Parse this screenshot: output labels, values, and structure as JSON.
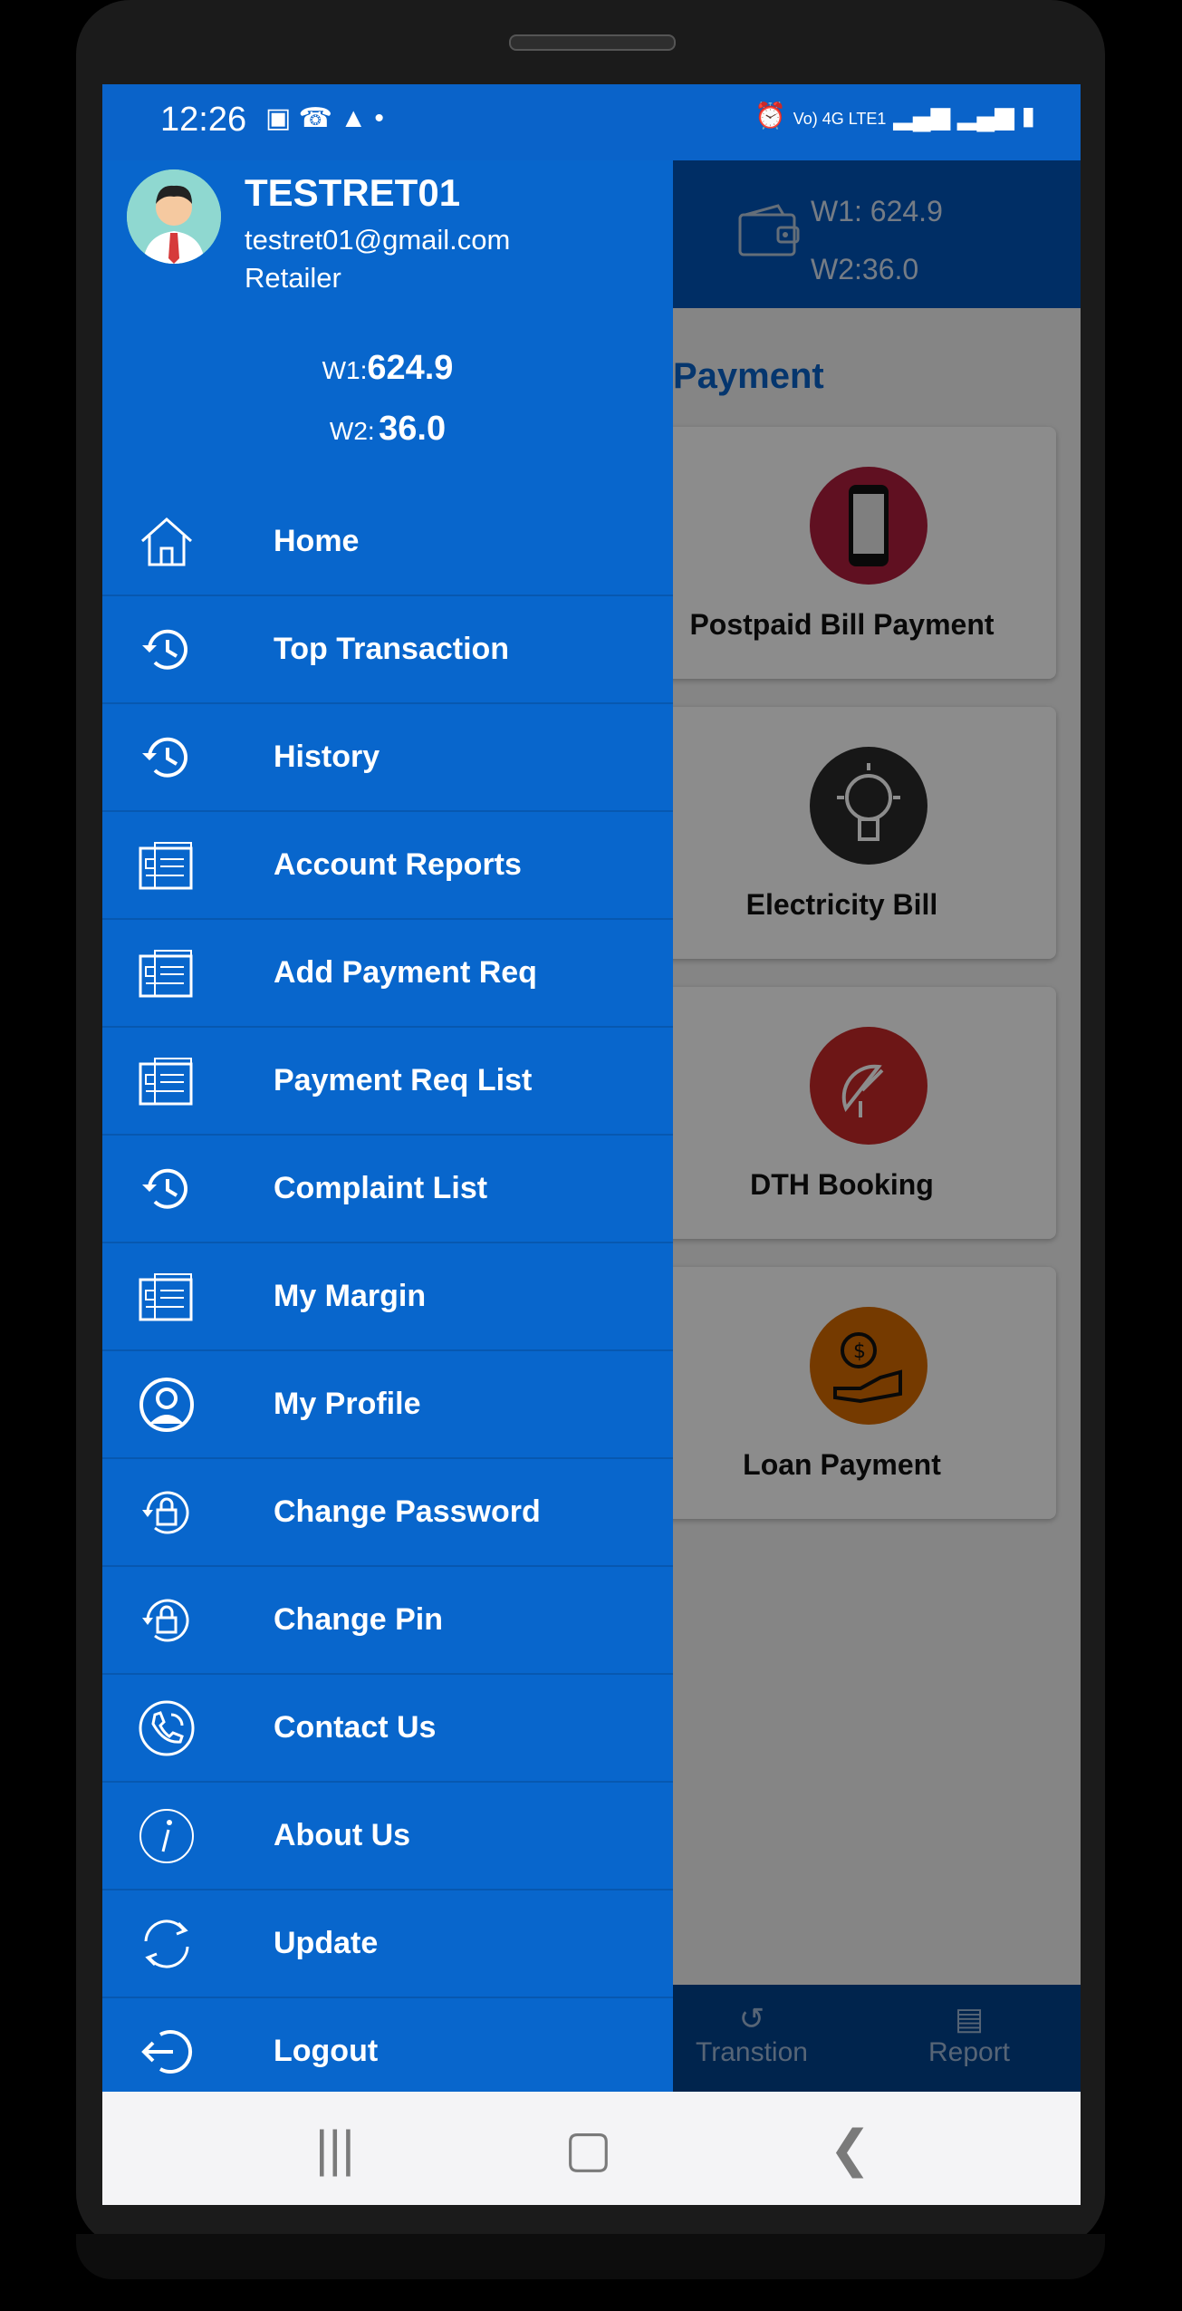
{
  "status_bar": {
    "time": "12:26",
    "network": "Vo) 4G LTE1"
  },
  "app": {
    "wallet": {
      "w1_key": "W1:",
      "w1_value": "624.9",
      "w2_key": "W2:",
      "w2_value": "36.0"
    },
    "section_title": "Payment",
    "cards": [
      {
        "label": "Postpaid Bill Payment",
        "icon": "mobile-phone-icon",
        "color": "#b01e3c"
      },
      {
        "label": "Electricity Bill",
        "icon": "light-bulb-icon",
        "color": "#2a2a2a"
      },
      {
        "label": "DTH Booking",
        "icon": "satellite-dish-icon",
        "color": "#c62828"
      },
      {
        "label": "Loan Payment",
        "icon": "hand-coin-icon",
        "color": "#d66a00"
      }
    ],
    "bottom_nav": {
      "transaction": "Transtion",
      "report": "Report"
    }
  },
  "drawer": {
    "user": {
      "name": "TESTRET01",
      "email": "testret01@gmail.com",
      "role": "Retailer"
    },
    "wallet": {
      "w1_key": "W1:",
      "w1_value": "624.9",
      "w2_key": "W2:",
      "w2_value": "36.0"
    },
    "menu": [
      {
        "label": "Home",
        "icon": "home-icon"
      },
      {
        "label": "Top Transaction",
        "icon": "history-icon"
      },
      {
        "label": "History",
        "icon": "history-icon"
      },
      {
        "label": "Account Reports",
        "icon": "report-icon"
      },
      {
        "label": "Add Payment Req",
        "icon": "report-icon"
      },
      {
        "label": "Payment Req List",
        "icon": "report-icon"
      },
      {
        "label": "Complaint List",
        "icon": "history-icon"
      },
      {
        "label": "My Margin",
        "icon": "report-icon"
      },
      {
        "label": "My Profile",
        "icon": "profile-icon"
      },
      {
        "label": "Change Password",
        "icon": "lock-reset-icon"
      },
      {
        "label": "Change Pin",
        "icon": "lock-reset-icon"
      },
      {
        "label": "Contact Us",
        "icon": "phone-call-icon"
      },
      {
        "label": "About Us",
        "icon": "info-icon"
      },
      {
        "label": "Update",
        "icon": "refresh-icon"
      },
      {
        "label": "Logout",
        "icon": "logout-icon"
      }
    ]
  },
  "colors": {
    "drawer": "#0866cc",
    "header": "#0055b8",
    "accent": "#0a63c9"
  }
}
